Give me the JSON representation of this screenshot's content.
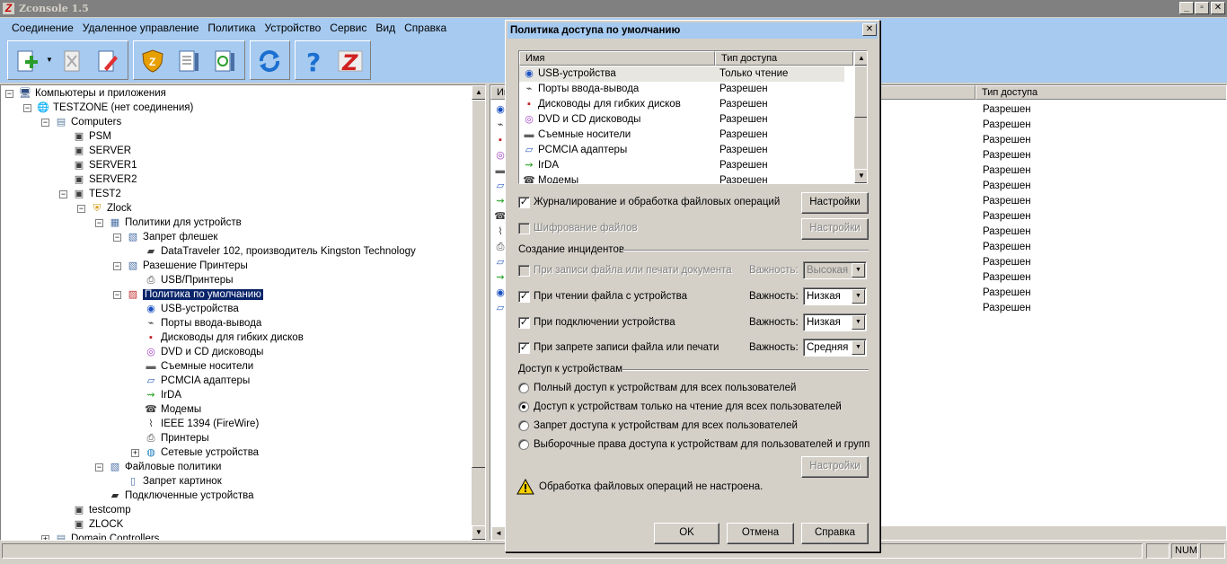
{
  "app": {
    "title": "Zconsole 1.5",
    "logo": "Z"
  },
  "menu": [
    "Соединение",
    "Удаленное управление",
    "Политика",
    "Устройство",
    "Сервис",
    "Вид",
    "Справка"
  ],
  "toolbar": {
    "buttons": [
      {
        "name": "add-button",
        "icon": "add-icon"
      },
      {
        "name": "delete-button",
        "icon": "delete-icon"
      },
      {
        "name": "edit-button",
        "icon": "edit-icon"
      },
      {
        "name": "zlock-button",
        "icon": "shield-icon"
      },
      {
        "name": "settings-button",
        "icon": "settings-icon"
      },
      {
        "name": "sync-settings-button",
        "icon": "sync-settings-icon"
      },
      {
        "name": "refresh-button",
        "icon": "refresh-icon"
      },
      {
        "name": "help-button",
        "icon": "help-icon"
      },
      {
        "name": "about-button",
        "icon": "z-logo-icon"
      }
    ]
  },
  "tree": [
    {
      "label": "Компьютеры и приложения",
      "icon": "computers-apps-icon",
      "exp": "-"
    },
    {
      "label": "TESTZONE (нет соединения)",
      "icon": "globe-icon",
      "exp": "-"
    },
    {
      "label": "Computers",
      "icon": "computers-folder-icon",
      "exp": "-"
    },
    {
      "label": "PSM",
      "icon": "computer-icon",
      "exp": ""
    },
    {
      "label": "SERVER",
      "icon": "computer-icon",
      "exp": ""
    },
    {
      "label": "SERVER1",
      "icon": "computer-icon",
      "exp": ""
    },
    {
      "label": "SERVER2",
      "icon": "computer-icon",
      "exp": ""
    },
    {
      "label": "TEST2",
      "icon": "computer-icon",
      "exp": "-"
    },
    {
      "label": "Zlock",
      "icon": "zlock-shield-icon",
      "exp": "-"
    },
    {
      "label": "Политики для устройств",
      "icon": "policies-icon",
      "exp": "-"
    },
    {
      "label": "Запрет флешек",
      "icon": "policy-icon",
      "exp": "-"
    },
    {
      "label": "DataTraveler 102, производитель Kingston Technology",
      "icon": "usb-drive-icon",
      "exp": ""
    },
    {
      "label": "Разешение Принтеры",
      "icon": "policy-icon",
      "exp": "-"
    },
    {
      "label": "USB/Принтеры",
      "icon": "printer-icon",
      "exp": ""
    },
    {
      "label": "Политика по умолчанию",
      "icon": "default-policy-icon",
      "exp": "-",
      "selected": true
    },
    {
      "label": "USB-устройства",
      "icon": "usb-icon",
      "exp": ""
    },
    {
      "label": "Порты ввода-вывода",
      "icon": "port-icon",
      "exp": ""
    },
    {
      "label": "Дисководы для гибких дисков",
      "icon": "floppy-icon",
      "exp": ""
    },
    {
      "label": "DVD и CD дисководы",
      "icon": "cd-icon",
      "exp": ""
    },
    {
      "label": "Съемные носители",
      "icon": "removable-icon",
      "exp": ""
    },
    {
      "label": "PCMCIA адаптеры",
      "icon": "pcmcia-icon",
      "exp": ""
    },
    {
      "label": "IrDA",
      "icon": "irda-icon",
      "exp": ""
    },
    {
      "label": "Модемы",
      "icon": "modem-icon",
      "exp": ""
    },
    {
      "label": "IEEE 1394 (FireWire)",
      "icon": "firewire-icon",
      "exp": ""
    },
    {
      "label": "Принтеры",
      "icon": "printer-icon",
      "exp": ""
    },
    {
      "label": "Сетевые устройства",
      "icon": "network-icon",
      "exp": "+"
    },
    {
      "label": "Файловые политики",
      "icon": "file-policies-icon",
      "exp": "-"
    },
    {
      "label": "Запрет картинок",
      "icon": "file-policy-icon",
      "exp": ""
    },
    {
      "label": "Подключенные устройства",
      "icon": "connected-devices-icon",
      "exp": ""
    },
    {
      "label": "testcomp",
      "icon": "computer-icon",
      "exp": ""
    },
    {
      "label": "ZLOCK",
      "icon": "computer-icon",
      "exp": ""
    },
    {
      "label": "Domain Controllers",
      "icon": "computers-folder-icon",
      "exp": "+"
    }
  ],
  "right_panel": {
    "col1": "Им",
    "col2": "Тип доступа",
    "rows": [
      "Разрешен",
      "Разрешен",
      "Разрешен",
      "Разрешен",
      "Разрешен",
      "Разрешен",
      "Разрешен",
      "Разрешен",
      "Разрешен",
      "Разрешен",
      "Разрешен",
      "Разрешен",
      "Разрешен",
      "Разрешен"
    ]
  },
  "dialog": {
    "title": "Политика доступа по умолчанию",
    "list_headers": [
      "Имя",
      "Тип доступа"
    ],
    "list": [
      {
        "name": "USB-устройства",
        "access": "Только чтение",
        "icon": "usb-icon"
      },
      {
        "name": "Порты ввода-вывода",
        "access": "Разрешен",
        "icon": "port-icon"
      },
      {
        "name": "Дисководы для гибких дисков",
        "access": "Разрешен",
        "icon": "floppy-icon"
      },
      {
        "name": "DVD и CD дисководы",
        "access": "Разрешен",
        "icon": "cd-icon"
      },
      {
        "name": "Съемные носители",
        "access": "Разрешен",
        "icon": "removable-icon"
      },
      {
        "name": "PCMCIA адаптеры",
        "access": "Разрешен",
        "icon": "pcmcia-icon"
      },
      {
        "name": "IrDA",
        "access": "Разрешен",
        "icon": "irda-icon"
      },
      {
        "name": "Модемы",
        "access": "Разрешен",
        "icon": "modem-icon"
      }
    ],
    "logging_label": "Журналирование и обработка файловых операций",
    "settings_label": "Настройки",
    "encryption_label": "Шифрование файлов",
    "incidents_title": "Создание инцидентов",
    "importance_label": "Важность:",
    "incidents": [
      {
        "label": "При записи файла или печати документа",
        "checked": false,
        "disabled": true,
        "level": "Высокая"
      },
      {
        "label": "При чтении файла с устройства",
        "checked": true,
        "disabled": false,
        "level": "Низкая"
      },
      {
        "label": "При подключении устройства",
        "checked": true,
        "disabled": false,
        "level": "Низкая"
      },
      {
        "label": "При запрете записи файла или печати",
        "checked": true,
        "disabled": false,
        "level": "Средняя"
      }
    ],
    "access_title": "Доступ к устройствам",
    "access_options": [
      {
        "label": "Полный доступ к устройствам для всех пользователей",
        "selected": false
      },
      {
        "label": "Доступ к устройствам только на чтение для всех пользователей",
        "selected": true
      },
      {
        "label": "Запрет доступа к устройствам для всех пользователей",
        "selected": false
      },
      {
        "label": "Выборочные права доступа к устройствам для пользователей и групп",
        "selected": false
      }
    ],
    "warning": "Обработка файловых операций не настроена.",
    "ok": "OK",
    "cancel": "Отмена",
    "help": "Справка"
  },
  "status": {
    "num": "NUM"
  },
  "colors": {
    "chrome_blue": "#a6caf0",
    "face": "#d4d0c8",
    "selection": "#0a246a"
  }
}
